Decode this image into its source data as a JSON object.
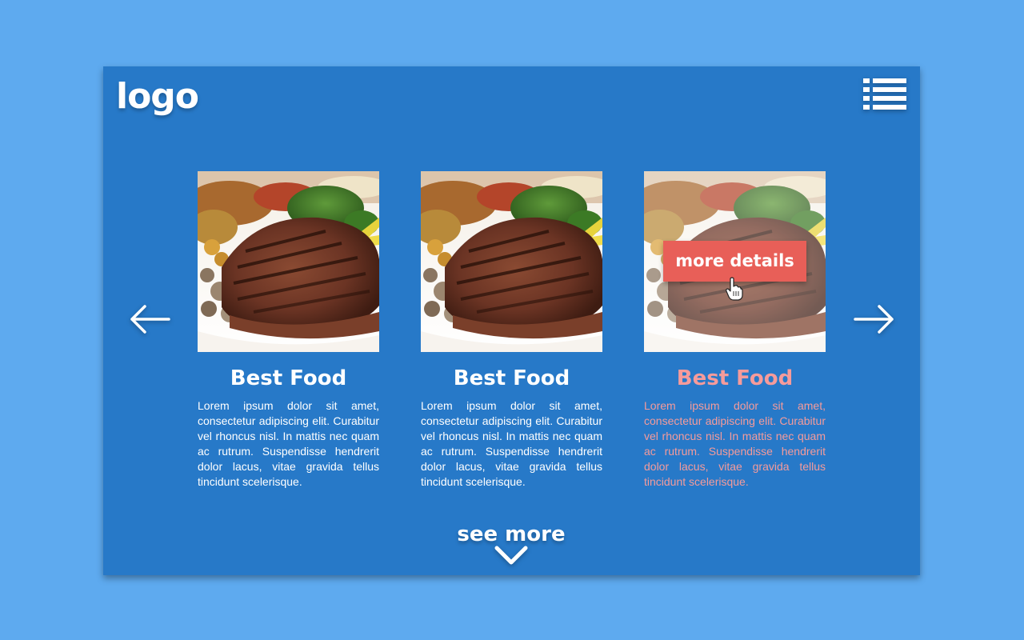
{
  "header": {
    "logo_text": "logo",
    "menu_icon": "hamburger-menu-icon"
  },
  "carousel": {
    "prev_icon": "arrow-left-icon",
    "next_icon": "arrow-right-icon",
    "cards": [
      {
        "image": "grilled-steak-photo",
        "title": "Best Food",
        "text": "Lorem ipsum dolor sit amet, consectetur adipiscing elit. Curabitur vel rhoncus nisl. In mattis nec quam ac rutrum. Suspendisse hendrerit dolor lacus, vitae gravida tellus tincidunt scelerisque."
      },
      {
        "image": "grilled-steak-photo",
        "title": "Best Food",
        "text": "Lorem ipsum dolor sit amet, consectetur adipiscing elit. Curabitur vel rhoncus nisl. In mattis nec quam ac rutrum. Suspendisse hendrerit dolor lacus, vitae gravida tellus tincidunt scelerisque."
      },
      {
        "image": "grilled-steak-photo",
        "title": "Best Food",
        "text": "Lorem ipsum dolor sit amet, consectetur adipiscing elit. Curabitur vel rhoncus nisl. In mattis nec quam ac rutrum. Suspendisse hendrerit dolor lacus, vitae gravida tellus tincidunt scelerisque.",
        "active": true,
        "button_label": "more details"
      }
    ]
  },
  "footer": {
    "see_more_label": "see more",
    "chevron_icon": "chevron-down-icon"
  },
  "colors": {
    "background": "#5eaaef",
    "panel": "#2779c8",
    "accent": "#e85f58",
    "active_text": "#f59b9b",
    "text": "#ffffff"
  }
}
